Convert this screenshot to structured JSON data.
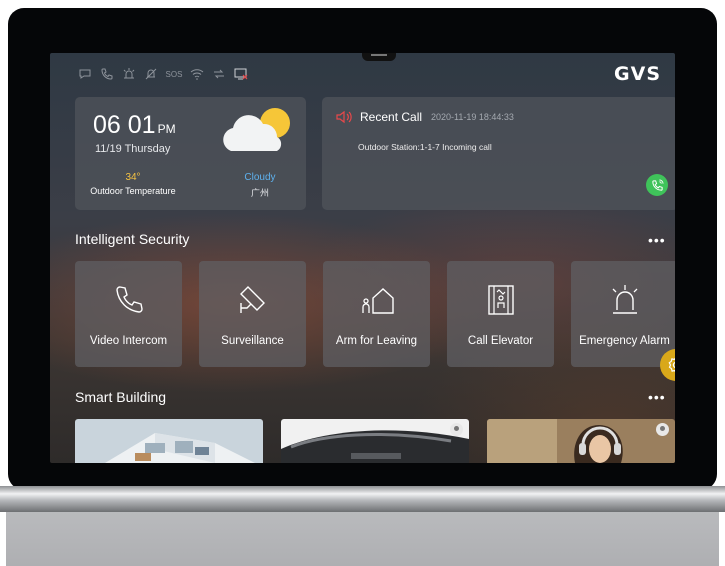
{
  "brand": {
    "logo": "GVS"
  },
  "status_icons": [
    "message-icon",
    "phone-icon",
    "alarm-icon",
    "mute-icon",
    "sos-icon",
    "wifi-icon",
    "link-icon",
    "monitor-off-icon"
  ],
  "status_icon_text": {
    "sos": "SOS"
  },
  "clock": {
    "time": "06 01",
    "ampm": "PM",
    "date": "11/19  Thursday"
  },
  "weather": {
    "temperature": "34°",
    "temperature_label": "Outdoor Temperature",
    "condition": "Cloudy",
    "city": "广州",
    "icon": "cloud-sun-icon"
  },
  "recent_call": {
    "title": "Recent Call",
    "timestamp": "2020-11-19 18:44:33",
    "detail": "Outdoor Station:1-1-7 Incoming call",
    "icon": "speaker-icon",
    "action_icon": "phone-call-icon"
  },
  "security": {
    "title": "Intelligent Security",
    "more": "•••",
    "items": [
      {
        "label": "Video Intercom",
        "icon": "phone-icon"
      },
      {
        "label": "Surveillance",
        "icon": "camera-icon"
      },
      {
        "label": "Arm for Leaving",
        "icon": "home-person-icon"
      },
      {
        "label": "Call Elevator",
        "icon": "elevator-icon"
      },
      {
        "label": "Emergency Alarm",
        "icon": "siren-icon"
      }
    ]
  },
  "building": {
    "title": "Smart Building",
    "more": "•••",
    "thumbnails": [
      "apartment-floorplan",
      "car",
      "headphones-woman"
    ]
  },
  "colors": {
    "accent": "#d9a81a",
    "call_green": "#3fc35a",
    "temp_yellow": "#f5c342",
    "cond_blue": "#5eb1ee",
    "recent_red": "#e8484a"
  }
}
